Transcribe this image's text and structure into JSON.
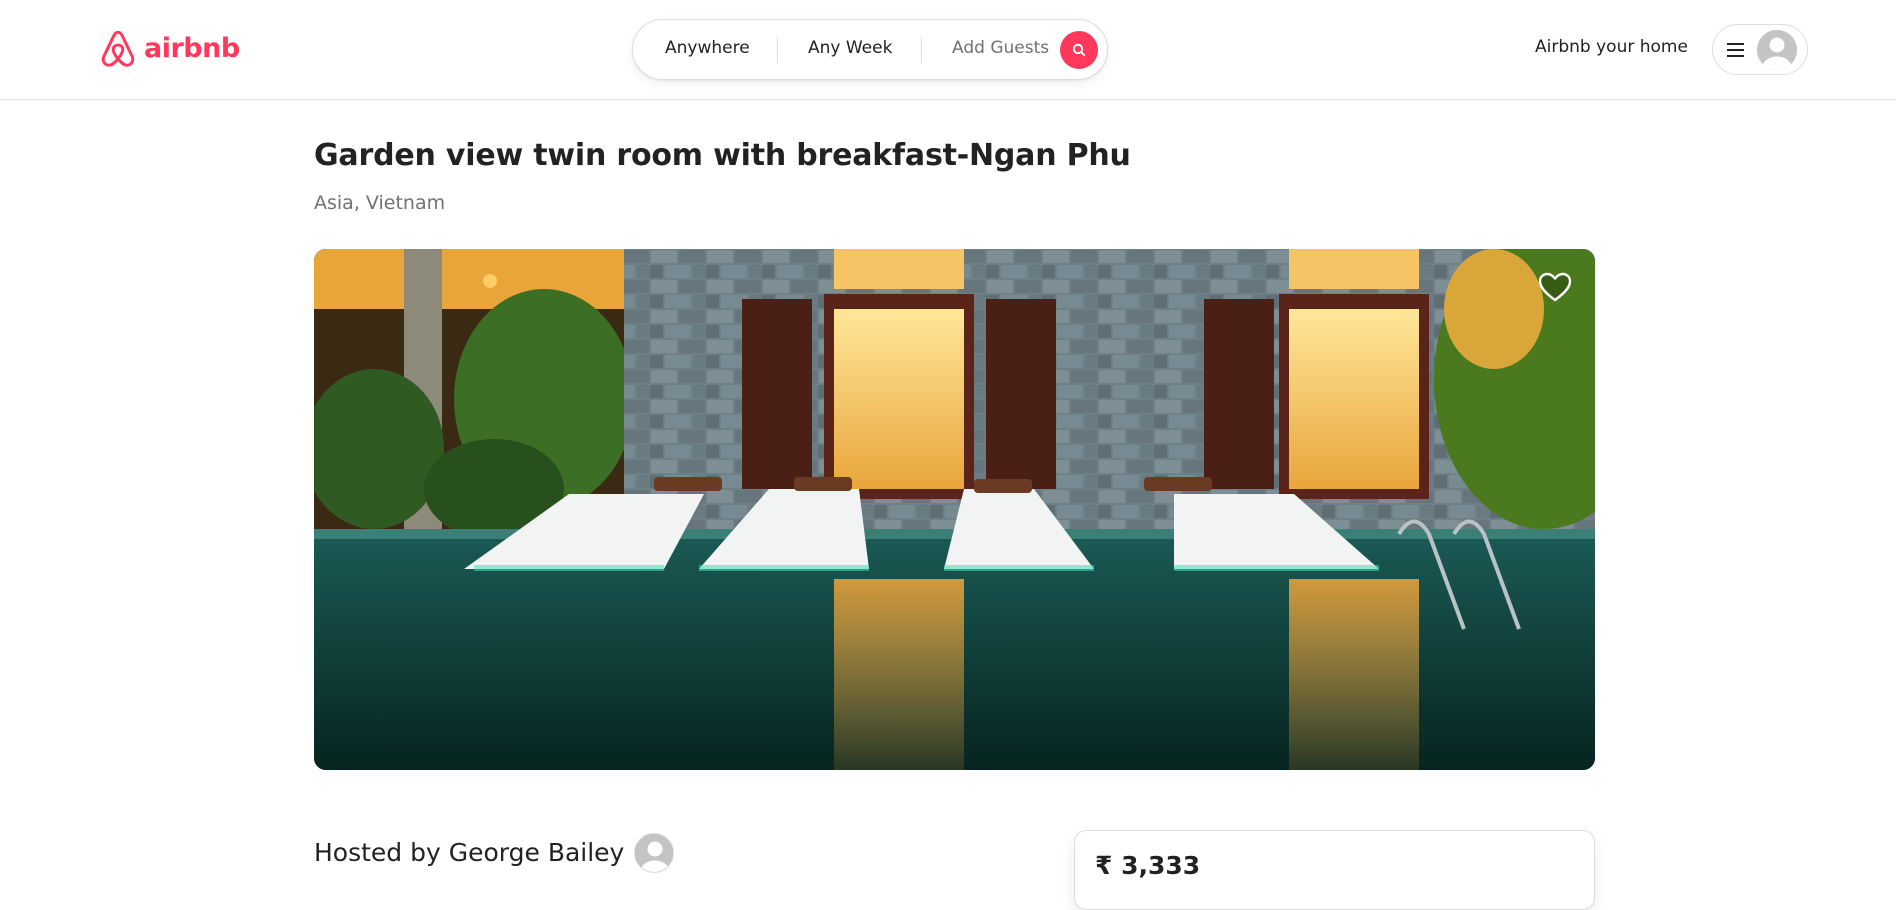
{
  "brand": {
    "name": "airbnb",
    "color": "#FF385C",
    "logo_icon": "airbnb-belo-logo"
  },
  "search": {
    "where": "Anywhere",
    "when": "Any Week",
    "guests": "Add Guests",
    "button_icon": "search-icon"
  },
  "header": {
    "host_link": "Airbnb your home",
    "menu_icon": "hamburger-menu-icon",
    "avatar_icon": "user-avatar-icon"
  },
  "listing": {
    "title": "Garden view twin room with breakfast-Ngan Phu",
    "location": "Asia, Vietnam",
    "photo_alt": "Pool with white sun loungers in front of lit windows at night",
    "favorite_icon": "heart-icon",
    "host_line": "Hosted by George Bailey",
    "price": "₹ 3,333"
  }
}
